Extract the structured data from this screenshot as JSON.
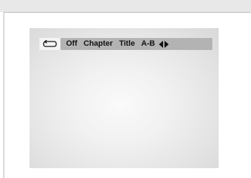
{
  "repeat_menu": {
    "icon": "repeat-icon",
    "options": [
      "Off",
      "Chapter",
      "Title",
      "A-B"
    ],
    "arrows_icon": "left-right-arrows-icon"
  },
  "colors": {
    "menu_bar": "#b3b3b3",
    "icon_box": "#f4f4f4",
    "text": "#111111"
  }
}
